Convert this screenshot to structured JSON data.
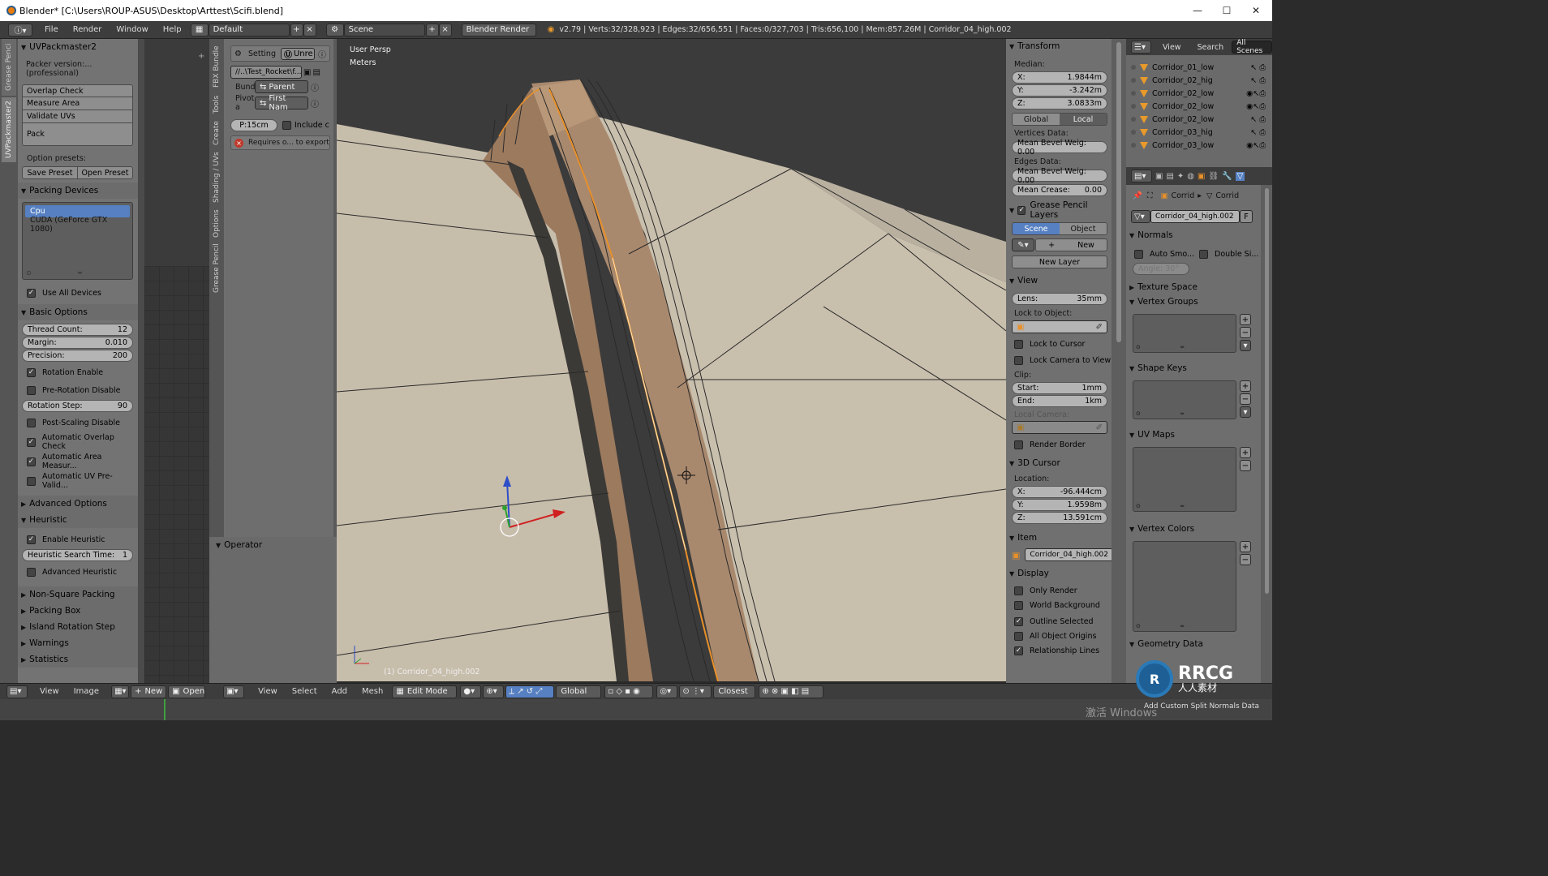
{
  "window": {
    "title": "Blender* [C:\\Users\\ROUP-ASUS\\Desktop\\Arttest\\Scifi.blend]",
    "minimize": "—",
    "maximize": "☐",
    "close": "✕"
  },
  "topbar": {
    "menus": [
      "File",
      "Render",
      "Window",
      "Help"
    ],
    "layout": "Default",
    "scene": "Scene",
    "engine": "Blender Render",
    "stats": "v2.79 | Verts:32/328,923 | Edges:32/656,551 | Faces:0/327,703 | Tris:656,100 | Mem:857.26M | Corridor_04_high.002"
  },
  "left_panel": {
    "title": "UVPackmaster2",
    "version": "Packer version:... (professional)",
    "buttons": [
      "Overlap Check",
      "Measure Area",
      "Validate UVs",
      "Pack"
    ],
    "option_presets_label": "Option presets:",
    "save_preset": "Save Preset",
    "open_preset": "Open Preset",
    "packing_devices": {
      "title": "Packing Devices",
      "items": [
        "Cpu",
        "CUDA (GeForce GTX 1080)"
      ],
      "selected": "Cpu",
      "use_all": "Use All Devices"
    },
    "basic_options": {
      "title": "Basic Options",
      "thread_count_label": "Thread Count:",
      "thread_count": "12",
      "margin_label": "Margin:",
      "margin": "0.010",
      "precision_label": "Precision:",
      "precision": "200",
      "rotation_enable": "Rotation Enable",
      "pre_rotation_disable": "Pre-Rotation Disable",
      "rotation_step_label": "Rotation Step:",
      "rotation_step": "90",
      "post_scaling_disable": "Post-Scaling Disable",
      "auto_overlap": "Automatic Overlap Check",
      "auto_area": "Automatic Area Measur...",
      "auto_uv": "Automatic UV Pre-Valid..."
    },
    "advanced_options": "Advanced Options",
    "heuristic": {
      "title": "Heuristic",
      "enable": "Enable Heuristic",
      "search_time_label": "Heuristic Search Time:",
      "search_time": "1",
      "advanced": "Advanced Heuristic"
    },
    "collapsed": [
      "Non-Square Packing",
      "Packing Box",
      "Island Rotation Step",
      "Warnings",
      "Statistics"
    ]
  },
  "side_tabs_left": [
    "UVPackmaster2",
    "Grease Penci"
  ],
  "side_tabs_mid": [
    "FBX Bundle",
    "Tools",
    "Create",
    "Shading / UVs",
    "Options",
    "Grease Pencil"
  ],
  "toolshelf": {
    "setting": "Setting",
    "unreal": "Unre",
    "path": "//..\\Test_Rocket\\f...",
    "bundle_label": "Bundl",
    "parent": "Parent",
    "pivot_label": "Pivot a",
    "first_name": "First Nam",
    "p15": "P:15cm",
    "include": "Include c",
    "requires": "Requires o... to export",
    "operator": "Operator"
  },
  "viewport": {
    "view_name": "User Persp",
    "units": "Meters",
    "object_label": "(1) Corridor_04_high.002"
  },
  "n_panel": {
    "transform": {
      "title": "Transform",
      "median": "Median:",
      "x_label": "X:",
      "x": "1.9844m",
      "y_label": "Y:",
      "y": "-3.242m",
      "z_label": "Z:",
      "z": "3.0833m",
      "global": "Global",
      "local": "Local",
      "vertices_data": "Vertices Data:",
      "v_bevel": "Mean Bevel Weig: 0.00",
      "edges_data": "Edges Data:",
      "e_bevel": "Mean Bevel Weig: 0.00",
      "crease_label": "Mean Crease:",
      "crease": "0.00"
    },
    "grease": {
      "title": "Grease Pencil Layers",
      "scene": "Scene",
      "object": "Object",
      "new": "New",
      "new_layer": "New Layer"
    },
    "view": {
      "title": "View",
      "lens_label": "Lens:",
      "lens": "35mm",
      "lock_to_object": "Lock to Object:",
      "lock_cursor": "Lock to Cursor",
      "lock_camera": "Lock Camera to View",
      "clip": "Clip:",
      "start_label": "Start:",
      "start": "1mm",
      "end_label": "End:",
      "end": "1km",
      "local_camera": "Local Camera:",
      "render_border": "Render Border"
    },
    "cursor": {
      "title": "3D Cursor",
      "location": "Location:",
      "x_label": "X:",
      "x": "-96.444cm",
      "y_label": "Y:",
      "y": "1.9598m",
      "z_label": "Z:",
      "z": "13.591cm"
    },
    "item": {
      "title": "Item",
      "name": "Corridor_04_high.002"
    },
    "display": {
      "title": "Display",
      "only_render": "Only Render",
      "world_bg": "World Background",
      "outline": "Outline Selected",
      "origins": "All Object Origins",
      "relationship": "Relationship Lines"
    }
  },
  "outliner": {
    "view": "View",
    "search": "Search",
    "all_scenes": "All Scenes",
    "items": [
      "Corridor_01_low",
      "Corridor_02_hig",
      "Corridor_02_low",
      "Corridor_02_low",
      "Corridor_02_low",
      "Corridor_03_hig",
      "Corridor_03_low"
    ]
  },
  "properties": {
    "breadcrumb_a": "Corrid",
    "breadcrumb_b": "Corrid",
    "mesh_name": "Corridor_04_high.002",
    "f": "F",
    "normals": "Normals",
    "auto_smooth": "Auto Smo...",
    "double_sided": "Double Si...",
    "angle": "Angle: 30°",
    "texture_space": "Texture Space",
    "vertex_groups": "Vertex Groups",
    "shape_keys": "Shape Keys",
    "uv_maps": "UV Maps",
    "vertex_colors": "Vertex Colors",
    "geometry_data": "Geometry Data",
    "add_split": "Add Custom Split Normals Data"
  },
  "bottombar": {
    "view": "View",
    "image": "Image",
    "new": "New",
    "open": "Open",
    "view2": "View",
    "select": "Select",
    "add": "Add",
    "mesh": "Mesh",
    "mode": "Edit Mode",
    "orientation": "Global",
    "snap": "Closest"
  },
  "watermarks": {
    "rrcg": "RRCG",
    "cn": "人人素材",
    "windows": "激活 Windows"
  },
  "colors": {
    "selected_blue": "#5680c2",
    "panel_gray": "#737373",
    "mesh_beige": "#c9beab",
    "mesh_brown": "#9c7a5e",
    "edge_orange": "#e8902a"
  }
}
